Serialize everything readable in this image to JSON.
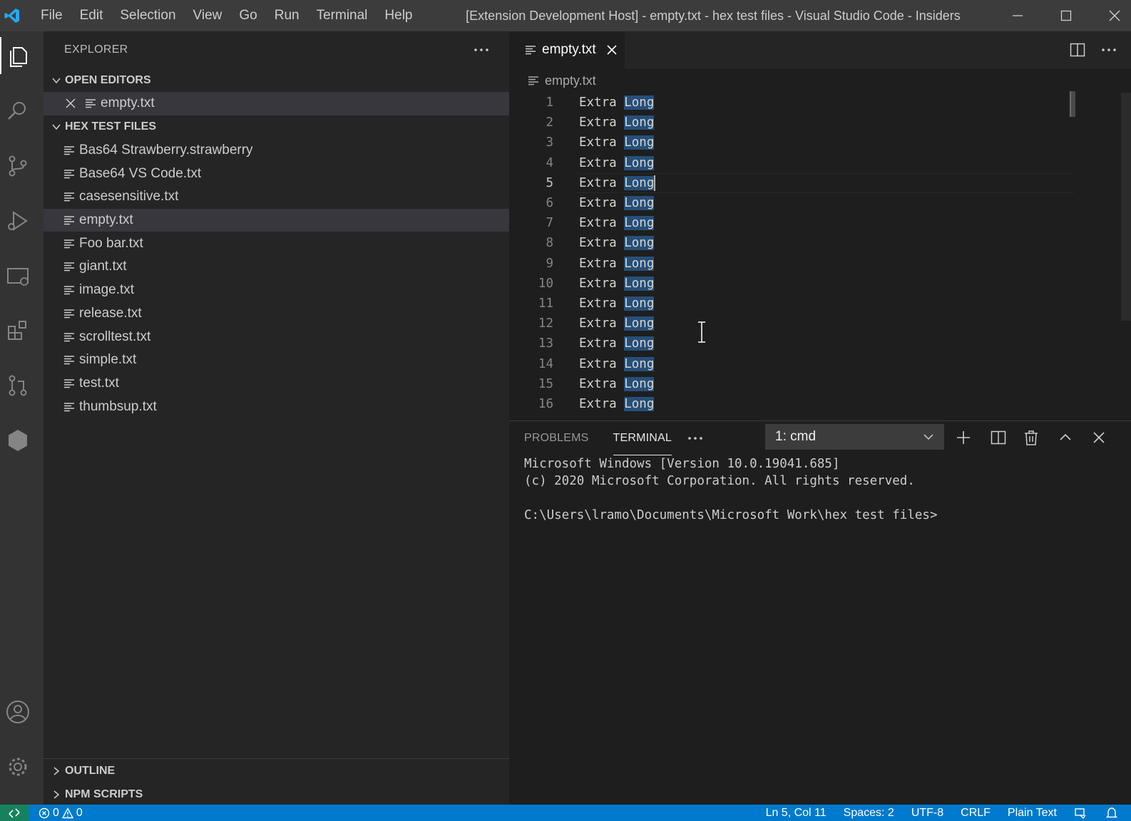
{
  "titlebar": {
    "menu": [
      "File",
      "Edit",
      "Selection",
      "View",
      "Go",
      "Run",
      "Terminal",
      "Help"
    ],
    "window_title": "[Extension Development Host] - empty.txt - hex test files - Visual Studio Code - Insiders"
  },
  "sidebar": {
    "title": "EXPLORER",
    "open_editors_label": "OPEN EDITORS",
    "open_editors": [
      {
        "name": "empty.txt"
      }
    ],
    "folder_label": "HEX TEST FILES",
    "files": [
      {
        "name": "Bas64 Strawberry.strawberry"
      },
      {
        "name": "Base64 VS Code.txt"
      },
      {
        "name": "casesensitive.txt"
      },
      {
        "name": "empty.txt",
        "selected": true
      },
      {
        "name": "Foo bar.txt"
      },
      {
        "name": "giant.txt"
      },
      {
        "name": "image.txt"
      },
      {
        "name": "release.txt"
      },
      {
        "name": "scrolltest.txt"
      },
      {
        "name": "simple.txt"
      },
      {
        "name": "test.txt"
      },
      {
        "name": "thumbsup.txt"
      }
    ],
    "outline_label": "OUTLINE",
    "npm_label": "NPM SCRIPTS"
  },
  "editor": {
    "tab_label": "empty.txt",
    "breadcrumb": "empty.txt",
    "current_line": 5,
    "lines": [
      {
        "num": "1",
        "word1": "Extra",
        "word2": "Long"
      },
      {
        "num": "2",
        "word1": "Extra",
        "word2": "Long"
      },
      {
        "num": "3",
        "word1": "Extra",
        "word2": "Long"
      },
      {
        "num": "4",
        "word1": "Extra",
        "word2": "Long"
      },
      {
        "num": "5",
        "word1": "Extra",
        "word2": "Long"
      },
      {
        "num": "6",
        "word1": "Extra",
        "word2": "Long"
      },
      {
        "num": "7",
        "word1": "Extra",
        "word2": "Long"
      },
      {
        "num": "8",
        "word1": "Extra",
        "word2": "Long"
      },
      {
        "num": "9",
        "word1": "Extra",
        "word2": "Long"
      },
      {
        "num": "10",
        "word1": "Extra",
        "word2": "Long"
      },
      {
        "num": "11",
        "word1": "Extra",
        "word2": "Long"
      },
      {
        "num": "12",
        "word1": "Extra",
        "word2": "Long"
      },
      {
        "num": "13",
        "word1": "Extra",
        "word2": "Long"
      },
      {
        "num": "14",
        "word1": "Extra",
        "word2": "Long"
      },
      {
        "num": "15",
        "word1": "Extra",
        "word2": "Long"
      },
      {
        "num": "16",
        "word1": "Extra",
        "word2": "Long"
      }
    ]
  },
  "panel": {
    "tabs": [
      "PROBLEMS",
      "TERMINAL"
    ],
    "active_tab": "TERMINAL",
    "terminal_select": "1: cmd",
    "terminal_lines": [
      "Microsoft Windows [Version 10.0.19041.685]",
      "(c) 2020 Microsoft Corporation. All rights reserved.",
      "",
      "C:\\Users\\lramo\\Documents\\Microsoft Work\\hex test files>"
    ]
  },
  "statusbar": {
    "errors": "0",
    "warnings": "0",
    "position": "Ln 5, Col 11",
    "spaces": "Spaces: 2",
    "encoding": "UTF-8",
    "eol": "CRLF",
    "language": "Plain Text"
  },
  "colors": {
    "accent": "#007acc",
    "remote": "#16825d",
    "selection": "#264f78"
  }
}
